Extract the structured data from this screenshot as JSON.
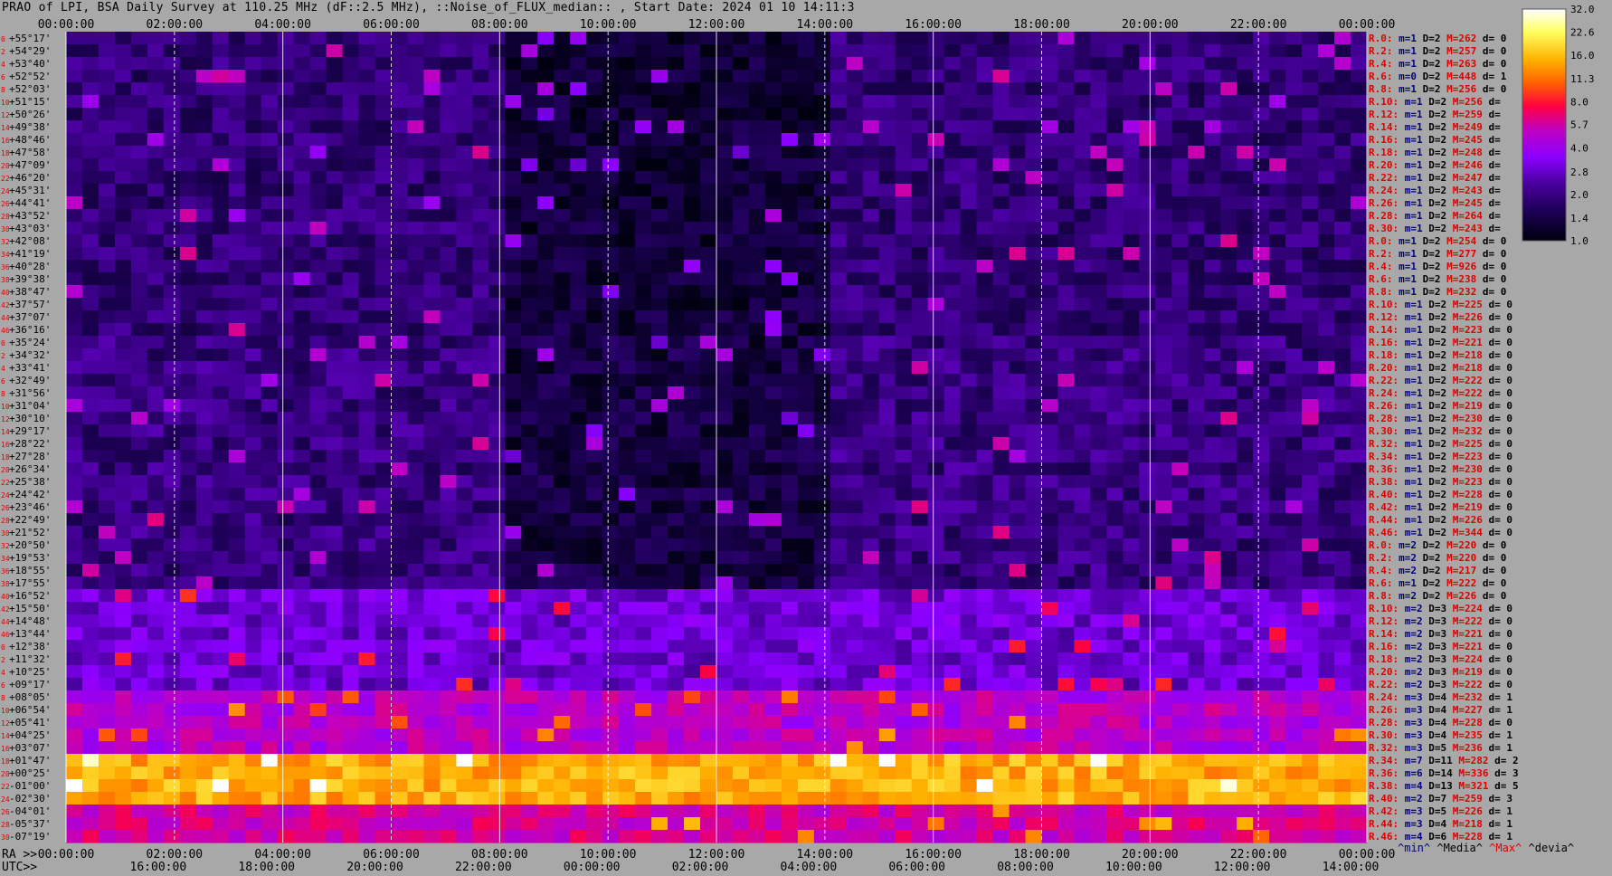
{
  "title": "PRAO of LPI, BSA Daily Survey at 110.25 MHz (dF::2.5 MHz), ::Noise_of_FLUX_median:: , Start Date: 2024 01 10 14:11:3",
  "chart_data": {
    "type": "heatmap",
    "top_time_ticks": [
      "00:00:00",
      "02:00:00",
      "04:00:00",
      "06:00:00",
      "08:00:00",
      "10:00:00",
      "12:00:00",
      "14:00:00",
      "16:00:00",
      "18:00:00",
      "20:00:00",
      "22:00:00",
      "00:00:00"
    ],
    "ra_ticks": [
      "00:00:00",
      "02:00:00",
      "04:00:00",
      "06:00:00",
      "08:00:00",
      "10:00:00",
      "12:00:00",
      "14:00:00",
      "16:00:00",
      "18:00:00",
      "20:00:00",
      "22:00:00",
      "00:00:00"
    ],
    "utc_ticks": [
      "16:00:00",
      "18:00:00",
      "20:00:00",
      "22:00:00",
      "00:00:00",
      "02:00:00",
      "04:00:00",
      "06:00:00",
      "08:00:00",
      "10:00:00",
      "12:00:00",
      "14:00:00"
    ],
    "bottom_labels": {
      "ra_prefix": "RA >>",
      "utc_prefix": "UTC>>"
    },
    "row_indices": [
      "0",
      "2",
      "4",
      "6",
      "8",
      "10",
      "12",
      "14",
      "16",
      "18",
      "20",
      "22",
      "24",
      "26",
      "28",
      "30",
      "32",
      "34",
      "36",
      "38",
      "40",
      "42",
      "44",
      "46",
      "0",
      "2",
      "4",
      "6",
      "8",
      "10",
      "12",
      "14",
      "16",
      "18",
      "20",
      "22",
      "24",
      "26",
      "28",
      "30",
      "32",
      "34",
      "36",
      "38",
      "40",
      "42",
      "44",
      "46",
      "0",
      "2",
      "4",
      "6",
      "8",
      "10",
      "12",
      "14",
      "16",
      "18",
      "20",
      "22",
      "24",
      "26",
      "28",
      "30",
      "32",
      "34",
      "36",
      "38",
      "40",
      "42",
      "44",
      "46"
    ],
    "declinations": [
      "+55°17'",
      "+54°29'",
      "+53°40'",
      "+52°52'",
      "+52°03'",
      "+51°15'",
      "+50°26'",
      "+49°38'",
      "+48°46'",
      "+47°58'",
      "+47°09'",
      "+46°20'",
      "+45°31'",
      "+44°41'",
      "+43°52'",
      "+43°03'",
      "+42°08'",
      "+41°19'",
      "+40°28'",
      "+39°38'",
      "+38°47'",
      "+37°57'",
      "+37°07'",
      "+36°16'",
      "+35°24'",
      "+34°32'",
      "+33°41'",
      "+32°49'",
      "+31°56'",
      "+31°04'",
      "+30°10'",
      "+29°17'",
      "+28°22'",
      "+27°28'",
      "+26°34'",
      "+25°38'",
      "+24°42'",
      "+23°46'",
      "+22°49'",
      "+21°52'",
      "+20°50'",
      "+19°53'",
      "+18°55'",
      "+17°55'",
      "+16°52'",
      "+15°50'",
      "+14°48'",
      "+13°44'",
      "+12°38'",
      "+11°32'",
      "+10°25'",
      "+09°17'",
      "+08°05'",
      "+06°54'",
      "+05°41'",
      "+04°25'",
      "+03°07'",
      "+01°47'",
      "+00°25'",
      "-01°00'",
      "-02°30'",
      "-04°01'",
      "-05°37'",
      "-07°19'"
    ],
    "stats": [
      {
        "r": "R.0:",
        "m": "m=1",
        "D": "D=2",
        "M": "M=262",
        "d": "d= 0"
      },
      {
        "r": "R.2:",
        "m": "m=1",
        "D": "D=2",
        "M": "M=257",
        "d": "d= 0"
      },
      {
        "r": "R.4:",
        "m": "m=1",
        "D": "D=2",
        "M": "M=263",
        "d": "d= 0"
      },
      {
        "r": "R.6:",
        "m": "m=0",
        "D": "D=2",
        "M": "M=448",
        "d": "d= 1"
      },
      {
        "r": "R.8:",
        "m": "m=1",
        "D": "D=2",
        "M": "M=256",
        "d": "d= 0"
      },
      {
        "r": "R.10:",
        "m": "m=1",
        "D": "D=2",
        "M": "M=256",
        "d": "d="
      },
      {
        "r": "R.12:",
        "m": "m=1",
        "D": "D=2",
        "M": "M=259",
        "d": "d="
      },
      {
        "r": "R.14:",
        "m": "m=1",
        "D": "D=2",
        "M": "M=249",
        "d": "d="
      },
      {
        "r": "R.16:",
        "m": "m=1",
        "D": "D=2",
        "M": "M=245",
        "d": "d="
      },
      {
        "r": "R.18:",
        "m": "m=1",
        "D": "D=2",
        "M": "M=248",
        "d": "d="
      },
      {
        "r": "R.20:",
        "m": "m=1",
        "D": "D=2",
        "M": "M=246",
        "d": "d="
      },
      {
        "r": "R.22:",
        "m": "m=1",
        "D": "D=2",
        "M": "M=247",
        "d": "d="
      },
      {
        "r": "R.24:",
        "m": "m=1",
        "D": "D=2",
        "M": "M=243",
        "d": "d="
      },
      {
        "r": "R.26:",
        "m": "m=1",
        "D": "D=2",
        "M": "M=245",
        "d": "d="
      },
      {
        "r": "R.28:",
        "m": "m=1",
        "D": "D=2",
        "M": "M=264",
        "d": "d="
      },
      {
        "r": "R.30:",
        "m": "m=1",
        "D": "D=2",
        "M": "M=243",
        "d": "d="
      },
      {
        "r": "R.0:",
        "m": "m=1",
        "D": "D=2",
        "M": "M=254",
        "d": "d= 0"
      },
      {
        "r": "R.2:",
        "m": "m=1",
        "D": "D=2",
        "M": "M=277",
        "d": "d= 0"
      },
      {
        "r": "R.4:",
        "m": "m=1",
        "D": "D=2",
        "M": "M=926",
        "d": "d= 0"
      },
      {
        "r": "R.6:",
        "m": "m=1",
        "D": "D=2",
        "M": "M=238",
        "d": "d= 0"
      },
      {
        "r": "R.8:",
        "m": "m=1",
        "D": "D=2",
        "M": "M=232",
        "d": "d= 0"
      },
      {
        "r": "R.10:",
        "m": "m=1",
        "D": "D=2",
        "M": "M=225",
        "d": "d= 0"
      },
      {
        "r": "R.12:",
        "m": "m=1",
        "D": "D=2",
        "M": "M=226",
        "d": "d= 0"
      },
      {
        "r": "R.14:",
        "m": "m=1",
        "D": "D=2",
        "M": "M=223",
        "d": "d= 0"
      },
      {
        "r": "R.16:",
        "m": "m=1",
        "D": "D=2",
        "M": "M=221",
        "d": "d= 0"
      },
      {
        "r": "R.18:",
        "m": "m=1",
        "D": "D=2",
        "M": "M=218",
        "d": "d= 0"
      },
      {
        "r": "R.20:",
        "m": "m=1",
        "D": "D=2",
        "M": "M=218",
        "d": "d= 0"
      },
      {
        "r": "R.22:",
        "m": "m=1",
        "D": "D=2",
        "M": "M=222",
        "d": "d= 0"
      },
      {
        "r": "R.24:",
        "m": "m=1",
        "D": "D=2",
        "M": "M=222",
        "d": "d= 0"
      },
      {
        "r": "R.26:",
        "m": "m=1",
        "D": "D=2",
        "M": "M=219",
        "d": "d= 0"
      },
      {
        "r": "R.28:",
        "m": "m=1",
        "D": "D=2",
        "M": "M=230",
        "d": "d= 0"
      },
      {
        "r": "R.30:",
        "m": "m=1",
        "D": "D=2",
        "M": "M=232",
        "d": "d= 0"
      },
      {
        "r": "R.32:",
        "m": "m=1",
        "D": "D=2",
        "M": "M=225",
        "d": "d= 0"
      },
      {
        "r": "R.34:",
        "m": "m=1",
        "D": "D=2",
        "M": "M=223",
        "d": "d= 0"
      },
      {
        "r": "R.36:",
        "m": "m=1",
        "D": "D=2",
        "M": "M=230",
        "d": "d= 0"
      },
      {
        "r": "R.38:",
        "m": "m=1",
        "D": "D=2",
        "M": "M=223",
        "d": "d= 0"
      },
      {
        "r": "R.40:",
        "m": "m=1",
        "D": "D=2",
        "M": "M=228",
        "d": "d= 0"
      },
      {
        "r": "R.42:",
        "m": "m=1",
        "D": "D=2",
        "M": "M=219",
        "d": "d= 0"
      },
      {
        "r": "R.44:",
        "m": "m=1",
        "D": "D=2",
        "M": "M=226",
        "d": "d= 0"
      },
      {
        "r": "R.46:",
        "m": "m=1",
        "D": "D=2",
        "M": "M=344",
        "d": "d= 0"
      },
      {
        "r": "R.0:",
        "m": "m=2",
        "D": "D=2",
        "M": "M=220",
        "d": "d= 0"
      },
      {
        "r": "R.2:",
        "m": "m=2",
        "D": "D=2",
        "M": "M=220",
        "d": "d= 0"
      },
      {
        "r": "R.4:",
        "m": "m=2",
        "D": "D=2",
        "M": "M=217",
        "d": "d= 0"
      },
      {
        "r": "R.6:",
        "m": "m=1",
        "D": "D=2",
        "M": "M=222",
        "d": "d= 0"
      },
      {
        "r": "R.8:",
        "m": "m=2",
        "D": "D=2",
        "M": "M=226",
        "d": "d= 0"
      },
      {
        "r": "R.10:",
        "m": "m=2",
        "D": "D=3",
        "M": "M=224",
        "d": "d= 0"
      },
      {
        "r": "R.12:",
        "m": "m=2",
        "D": "D=3",
        "M": "M=222",
        "d": "d= 0"
      },
      {
        "r": "R.14:",
        "m": "m=2",
        "D": "D=3",
        "M": "M=221",
        "d": "d= 0"
      },
      {
        "r": "R.16:",
        "m": "m=2",
        "D": "D=3",
        "M": "M=221",
        "d": "d= 0"
      },
      {
        "r": "R.18:",
        "m": "m=2",
        "D": "D=3",
        "M": "M=224",
        "d": "d= 0"
      },
      {
        "r": "R.20:",
        "m": "m=2",
        "D": "D=3",
        "M": "M=219",
        "d": "d= 0"
      },
      {
        "r": "R.22:",
        "m": "m=2",
        "D": "D=3",
        "M": "M=222",
        "d": "d= 0"
      },
      {
        "r": "R.24:",
        "m": "m=3",
        "D": "D=4",
        "M": "M=232",
        "d": "d= 1"
      },
      {
        "r": "R.26:",
        "m": "m=3",
        "D": "D=4",
        "M": "M=227",
        "d": "d= 1"
      },
      {
        "r": "R.28:",
        "m": "m=3",
        "D": "D=4",
        "M": "M=228",
        "d": "d= 0"
      },
      {
        "r": "R.30:",
        "m": "m=3",
        "D": "D=4",
        "M": "M=235",
        "d": "d= 1"
      },
      {
        "r": "R.32:",
        "m": "m=3",
        "D": "D=5",
        "M": "M=236",
        "d": "d= 1"
      },
      {
        "r": "R.34:",
        "m": "m=7",
        "D": "D=11",
        "M": "M=282",
        "d": "d= 2"
      },
      {
        "r": "R.36:",
        "m": "m=6",
        "D": "D=14",
        "M": "M=336",
        "d": "d= 3"
      },
      {
        "r": "R.38:",
        "m": "m=4",
        "D": "D=13",
        "M": "M=321",
        "d": "d= 5"
      },
      {
        "r": "R.40:",
        "m": "m=2",
        "D": "D=7",
        "M": "M=259",
        "d": "d= 3"
      },
      {
        "r": "R.42:",
        "m": "m=3",
        "D": "D=5",
        "M": "M=226",
        "d": "d= 1"
      },
      {
        "r": "R.44:",
        "m": "m=3",
        "D": "D=4",
        "M": "M=218",
        "d": "d= 1"
      },
      {
        "r": "R.46:",
        "m": "m=4",
        "D": "D=6",
        "M": "M=228",
        "d": "d= 1"
      }
    ],
    "stats_footer": [
      "^min^",
      "^Media^",
      "^Max^",
      "^devia^"
    ],
    "colorbar_ticks": [
      "32.0",
      "22.6",
      "16.0",
      "11.3",
      "8.0",
      "5.7",
      "4.0",
      "2.8",
      "2.0",
      "1.4",
      "1.0"
    ],
    "colorbar_range": [
      1.0,
      32.0
    ],
    "colorbar_scale": "log",
    "colormap": [
      "#000010",
      "#1a0050",
      "#4a00a0",
      "#8a00ff",
      "#c000c0",
      "#ff0040",
      "#ff6000",
      "#ffb000",
      "#ffff60",
      "#ffffff"
    ],
    "colors": {
      "label_red": "#e00000",
      "label_navy": "#000080",
      "label_black": "#000000",
      "background": "#a8a8a8"
    }
  }
}
